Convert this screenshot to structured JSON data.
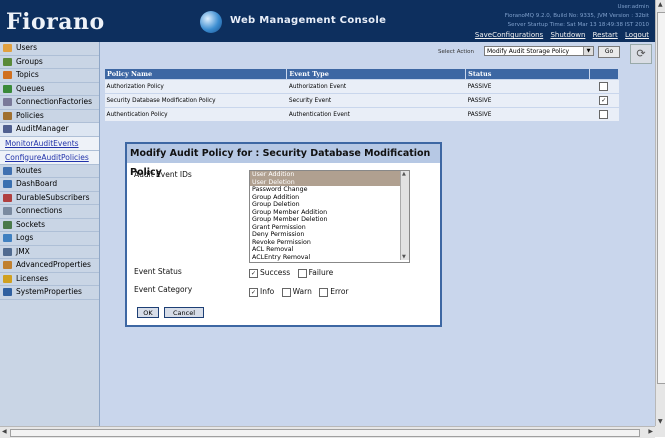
{
  "header": {
    "logo": "Fiorano",
    "title": "Web Management Console",
    "user": "User:admin",
    "build": "FioranoMQ 9.2.0, Build No: 9335, JVM Version : 32bit",
    "startup": "Server Startup Time: Sat Mar 13 18:49:38 IST 2010",
    "links": [
      "SaveConfigurations",
      "Shutdown",
      "Restart",
      "Logout"
    ]
  },
  "sidebar": {
    "items": [
      {
        "label": "Users",
        "icon": "users-icon",
        "color": "#e0a040"
      },
      {
        "label": "Groups",
        "icon": "groups-icon",
        "color": "#5a8a3a"
      },
      {
        "label": "Topics",
        "icon": "topics-icon",
        "color": "#d07020"
      },
      {
        "label": "Queues",
        "icon": "queues-icon",
        "color": "#3a8a3a"
      },
      {
        "label": "ConnectionFactories",
        "icon": "factory-icon",
        "color": "#7a7a9a"
      },
      {
        "label": "Policies",
        "icon": "policies-icon",
        "color": "#a07030"
      },
      {
        "label": "AuditManager",
        "icon": "audit-icon",
        "color": "#506090"
      }
    ],
    "subitems": [
      "MonitorAuditEvents",
      "ConfigureAuditPolicies"
    ],
    "items2": [
      {
        "label": "Routes",
        "icon": "routes-icon",
        "color": "#4070b0"
      },
      {
        "label": "DashBoard",
        "icon": "dashboard-icon",
        "color": "#3a70b0"
      },
      {
        "label": "DurableSubscribers",
        "icon": "durable-icon",
        "color": "#b04040"
      },
      {
        "label": "Connections",
        "icon": "connections-icon",
        "color": "#7a8aa0"
      },
      {
        "label": "Sockets",
        "icon": "sockets-icon",
        "color": "#4a7a4a"
      },
      {
        "label": "Logs",
        "icon": "logs-icon",
        "color": "#4080c0"
      },
      {
        "label": "JMX",
        "icon": "jmx-icon",
        "color": "#506a90"
      },
      {
        "label": "AdvancedProperties",
        "icon": "advanced-icon",
        "color": "#c08030"
      },
      {
        "label": "Licenses",
        "icon": "licenses-icon",
        "color": "#d0a020"
      },
      {
        "label": "SystemProperties",
        "icon": "system-icon",
        "color": "#3060a0"
      }
    ]
  },
  "toolbar": {
    "select_label": "Select Action",
    "select_value": "Modify Audit Storage Policy",
    "go_label": "Go"
  },
  "table": {
    "headers": [
      "Policy Name",
      "Event Type",
      "Status"
    ],
    "rows": [
      {
        "name": "Authorization Policy",
        "type": "Authorization Event",
        "status": "PASSIVE",
        "checked": ""
      },
      {
        "name": "Security Database Modification Policy",
        "type": "Security Event",
        "status": "PASSIVE",
        "checked": "✓"
      },
      {
        "name": "Authentication Policy",
        "type": "Authentication Event",
        "status": "PASSIVE",
        "checked": ""
      }
    ]
  },
  "dialog": {
    "title": "Modify Audit Policy for : Security Database Modification Policy",
    "event_ids_label": "Audit Event IDs",
    "event_ids": [
      "User Addition",
      "User Deletion",
      "Password Change",
      "Group Addition",
      "Group Deletion",
      "Group Member Addition",
      "Group Member Deletion",
      "Grant Permission",
      "Deny Permission",
      "Revoke Permission",
      "ACL Removal",
      "ACLEntry Removal"
    ],
    "selected_event_ids": [
      "User Addition",
      "User Deletion"
    ],
    "event_status_label": "Event Status",
    "status_options": [
      {
        "label": "Success",
        "checked": "✓"
      },
      {
        "label": "Failure",
        "checked": ""
      }
    ],
    "event_category_label": "Event Category",
    "category_options": [
      {
        "label": "Info",
        "checked": "✓"
      },
      {
        "label": "Warn",
        "checked": ""
      },
      {
        "label": "Error",
        "checked": ""
      }
    ],
    "ok_label": "OK",
    "cancel_label": "Cancel"
  }
}
